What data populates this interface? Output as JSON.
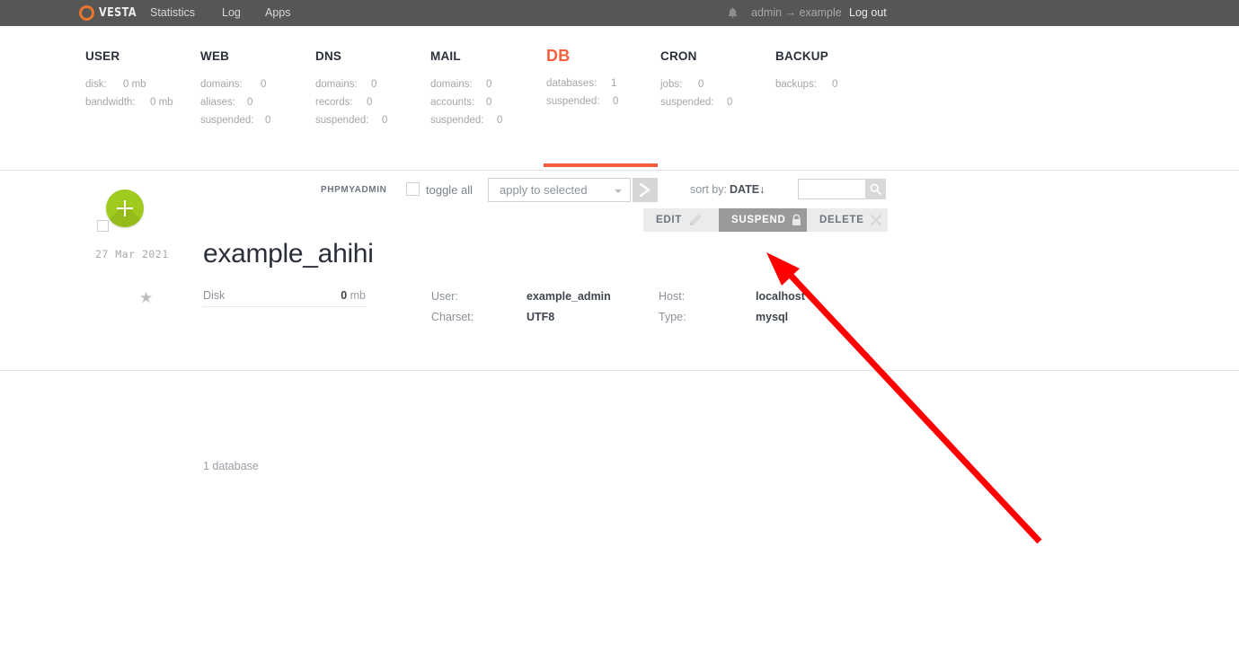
{
  "topbar": {
    "logo_text": "VESTA",
    "logo_icon": "vesta-ring-logo",
    "nav": [
      {
        "label": "Statistics",
        "name": "statistics"
      },
      {
        "label": "Log",
        "name": "log"
      },
      {
        "label": "Apps",
        "name": "apps"
      }
    ],
    "bell_icon": "bell-icon",
    "user_context": "admin → example",
    "logout_label": "Log out"
  },
  "stats": {
    "columns": [
      {
        "title": "USER",
        "active": false,
        "rows": [
          {
            "key": "disk:",
            "value": "0 mb"
          },
          {
            "key": "bandwidth:",
            "value": "0 mb"
          }
        ]
      },
      {
        "title": "WEB",
        "active": false,
        "rows": [
          {
            "key": "domains:",
            "value": "0"
          },
          {
            "key": "aliases:",
            "value": "0"
          },
          {
            "key": "suspended:",
            "value": "0"
          }
        ]
      },
      {
        "title": "DNS",
        "active": false,
        "rows": [
          {
            "key": "domains:",
            "value": "0"
          },
          {
            "key": "records:",
            "value": "0"
          },
          {
            "key": "suspended:",
            "value": "0"
          }
        ]
      },
      {
        "title": "MAIL",
        "active": false,
        "rows": [
          {
            "key": "domains:",
            "value": "0"
          },
          {
            "key": "accounts:",
            "value": "0"
          },
          {
            "key": "suspended:",
            "value": "0"
          }
        ]
      },
      {
        "title": "DB",
        "active": true,
        "rows": [
          {
            "key": "databases:",
            "value": "1"
          },
          {
            "key": "suspended:",
            "value": "0"
          }
        ]
      },
      {
        "title": "CRON",
        "active": false,
        "rows": [
          {
            "key": "jobs:",
            "value": "0"
          },
          {
            "key": "suspended:",
            "value": "0"
          }
        ]
      },
      {
        "title": "BACKUP",
        "active": false,
        "rows": [
          {
            "key": "backups:",
            "value": "0"
          }
        ]
      }
    ]
  },
  "toolbar": {
    "phpmyadmin_label": "PHPMYADMIN",
    "toggle_all_label": "toggle all",
    "apply_select_value": "apply to selected",
    "go_icon": "chevron-right-icon",
    "sort_by_label": "sort by:",
    "sort_by_value": "DATE",
    "sort_direction": "↓",
    "search_value": "",
    "search_placeholder": "",
    "search_icon": "search-icon"
  },
  "add_button": {
    "icon": "plus-icon",
    "color": "#9fcb1e"
  },
  "actions": [
    {
      "label": "EDIT",
      "icon": "pencil-icon",
      "highlighted": false,
      "name": "edit"
    },
    {
      "label": "SUSPEND",
      "icon": "lock-icon",
      "highlighted": true,
      "name": "suspend"
    },
    {
      "label": "DELETE",
      "icon": "close-icon",
      "highlighted": false,
      "name": "delete"
    }
  ],
  "record": {
    "date": "27 Mar 2021",
    "star_icon": "star-icon",
    "name": "example_ahihi",
    "disk": {
      "key": "Disk",
      "value": "0",
      "unit": "mb"
    },
    "fields": [
      {
        "key": "User:",
        "value": "example_admin"
      },
      {
        "key": "Charset:",
        "value": "UTF8"
      },
      {
        "key": "Host:",
        "value": "localhost"
      },
      {
        "key": "Type:",
        "value": "mysql"
      }
    ]
  },
  "footer": {
    "count_text": "1 database"
  },
  "annotation": {
    "type": "arrow",
    "color": "#ff0000",
    "points_to": "suspend-button"
  },
  "colors": {
    "topbar_bg": "#565656",
    "accent_orange": "#f4603e",
    "logo_orange": "#e8762b",
    "add_green": "#9fcb1e",
    "annotation_red": "#ff0000"
  }
}
